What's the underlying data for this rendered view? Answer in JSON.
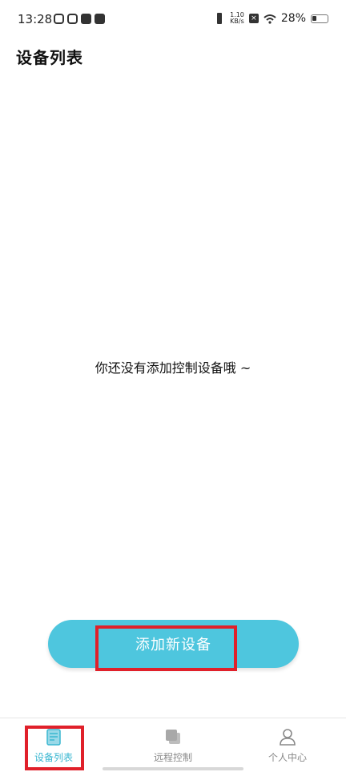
{
  "status_bar": {
    "time": "13:28",
    "speed_value": "1.10",
    "speed_unit": "KB/s",
    "battery": "28%"
  },
  "page": {
    "title": "设备列表",
    "empty_message": "你还没有添加控制设备哦 ~",
    "add_button_label": "添加新设备"
  },
  "bottom_nav": {
    "items": [
      {
        "label": "设备列表",
        "icon": "device-list-icon",
        "active": true
      },
      {
        "label": "远程控制",
        "icon": "remote-control-icon",
        "active": false
      },
      {
        "label": "个人中心",
        "icon": "profile-icon",
        "active": false
      }
    ]
  },
  "colors": {
    "accent": "#4ec6de",
    "active_nav": "#3ab7d1",
    "highlight": "#e0202a"
  }
}
